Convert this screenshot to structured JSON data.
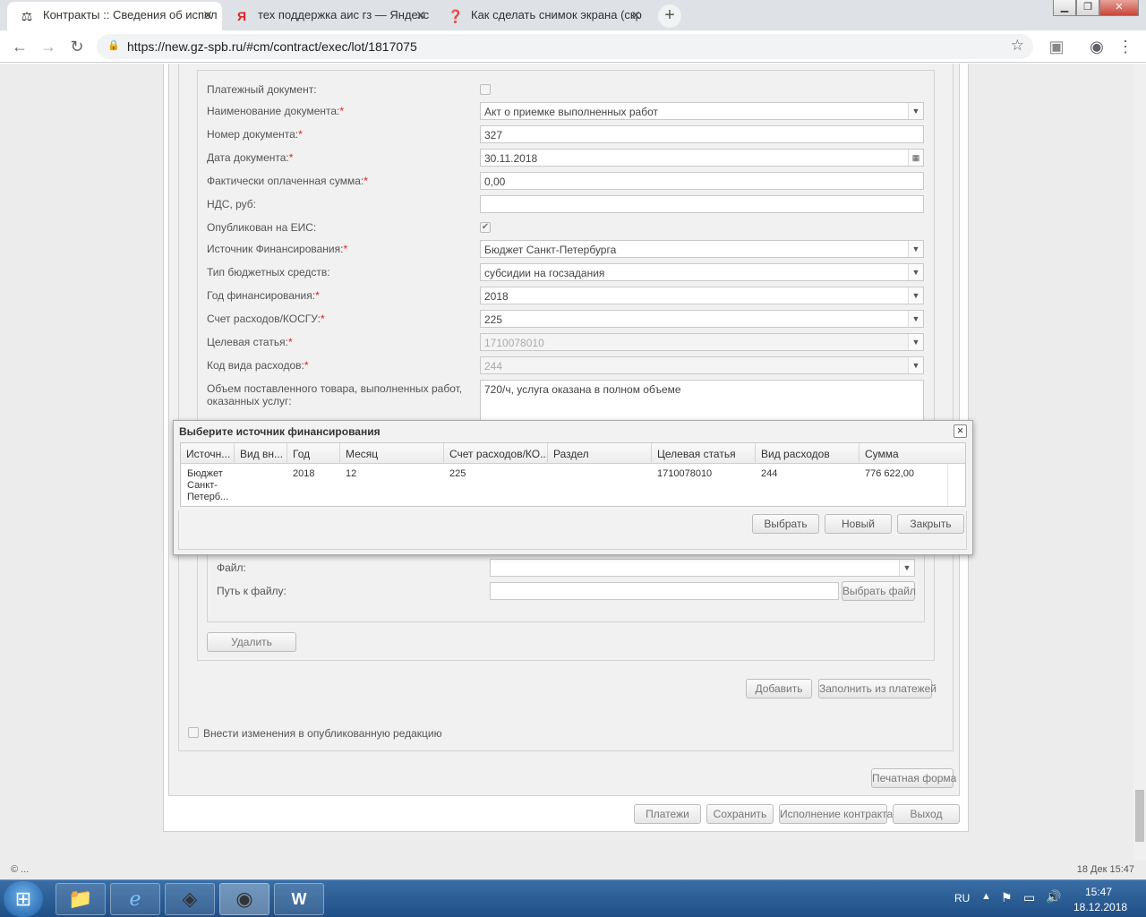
{
  "browser": {
    "tabs": [
      {
        "title": "Контракты :: Сведения об испол",
        "icon": "gavel-icon"
      },
      {
        "title": "тех поддержка аис гз — Яндекс",
        "icon": "yandex-icon"
      },
      {
        "title": "Как сделать снимок экрана (скр",
        "icon": "help-icon"
      }
    ],
    "url": "https://new.gz-spb.ru/#cm/contract/exec/lot/1817075"
  },
  "form": {
    "payment_doc_label": "Платежный документ:",
    "doc_name_label": "Наименование документа:",
    "doc_name_value": "Акт о приемке выполненных работ",
    "doc_number_label": "Номер документа:",
    "doc_number_value": "327",
    "doc_date_label": "Дата документа:",
    "doc_date_value": "30.11.2018",
    "paid_sum_label": "Фактически оплаченная сумма:",
    "paid_sum_value": "0,00",
    "vat_label": "НДС, руб:",
    "vat_value": "",
    "published_label": "Опубликован на ЕИС:",
    "published_checked": true,
    "fin_source_label": "Источник Финансирования:",
    "fin_source_value": "Бюджет Санкт-Петербурга",
    "budget_type_label": "Тип бюджетных средств:",
    "budget_type_value": "субсидии на госзадания",
    "fin_year_label": "Год финансирования:",
    "fin_year_value": "2018",
    "account_label": "Счет расходов/КОСГУ:",
    "account_value": "225",
    "target_label": "Целевая статья:",
    "target_value": "1710078010",
    "expense_code_label": "Код вида расходов:",
    "expense_code_value": "244",
    "volume_label": "Объем поставленного товара, выполненных работ, оказанных услуг:",
    "volume_value": "720/ч, услуга оказана в полном объеме",
    "file_label": "Файл:",
    "file_path_label": "Путь к файлу:",
    "choose_file_label": "Выбрать файл",
    "delete_label": "Удалить",
    "add_label": "Добавить",
    "fill_from_payments_label": "Заполнить из платежей",
    "amend_published_label": "Внести изменения в опубликованную редакцию",
    "print_form_label": "Печатная форма"
  },
  "footer_buttons": {
    "payments": "Платежи",
    "save": "Сохранить",
    "contract_execution": "Исполнение контракта",
    "exit": "Выход"
  },
  "modal": {
    "title": "Выберите источник финансирования",
    "columns": [
      "Источн...",
      "Вид вн...",
      "Год",
      "Месяц",
      "Счет расходов/КО...",
      "Раздел",
      "Целевая статья",
      "Вид расходов",
      "Сумма"
    ],
    "rows": [
      {
        "source": "Бюджет Санкт-Петерб...",
        "type": "",
        "year": "2018",
        "month": "12",
        "account": "225",
        "section": "",
        "target": "1710078010",
        "expense": "244",
        "sum": "776 622,00"
      }
    ],
    "select_label": "Выбрать",
    "new_label": "Новый",
    "close_label": "Закрыть"
  },
  "status": {
    "left": "© ...",
    "right": "18 Дек 15:47"
  },
  "taskbar": {
    "lang": "RU",
    "time": "15:47",
    "date": "18.12.2018"
  }
}
